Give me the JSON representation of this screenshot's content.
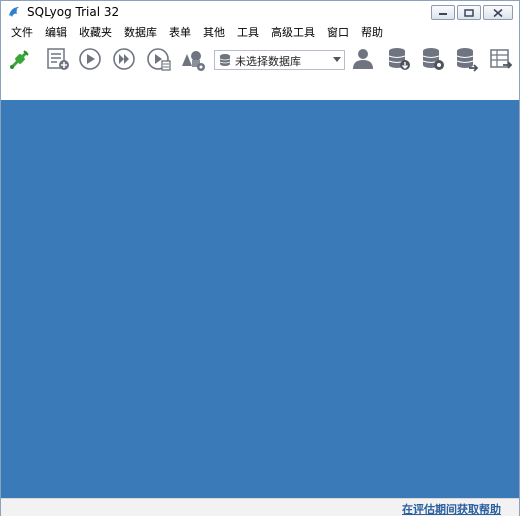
{
  "window": {
    "title": "SQLyog Trial 32",
    "controls": [
      "minimize-icon",
      "maximize-icon",
      "close-icon"
    ]
  },
  "menu": {
    "items": [
      "文件",
      "编辑",
      "收藏夹",
      "数据库",
      "表单",
      "其他",
      "工具",
      "高级工具",
      "窗口",
      "帮助"
    ]
  },
  "toolbar": {
    "buttons": [
      {
        "icon": "connect-plug-icon"
      },
      {
        "icon": "new-query-editor-icon"
      },
      {
        "icon": "execute-query-icon"
      },
      {
        "icon": "execute-all-queries-icon"
      },
      {
        "icon": "execute-query-edit-result-icon"
      },
      {
        "icon": "schema-designer-icon"
      },
      {
        "icon": "user-manager-icon"
      },
      {
        "icon": "backup-database-icon"
      },
      {
        "icon": "database-settings-icon"
      },
      {
        "icon": "database-sync-icon"
      },
      {
        "icon": "table-export-icon"
      }
    ],
    "database_select": {
      "selected": "未选择数据库"
    }
  },
  "status": {
    "help_link": "在评估期间获取帮助"
  },
  "colors": {
    "workspace": "#3b7ab8",
    "accent_green": "#3aa63a",
    "icon_gray": "#6e7580",
    "link": "#2a5fa0"
  }
}
